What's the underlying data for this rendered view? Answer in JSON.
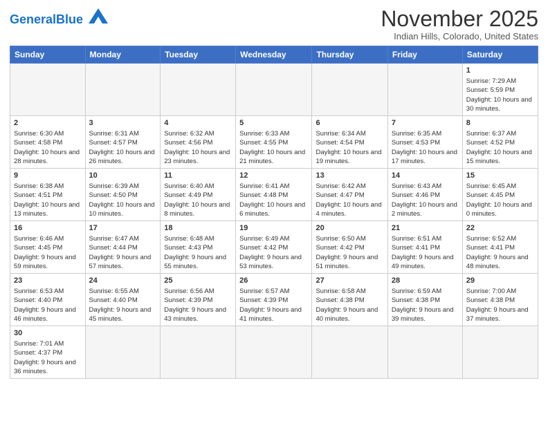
{
  "logo": {
    "text_general": "General",
    "text_blue": "Blue"
  },
  "title": "November 2025",
  "subtitle": "Indian Hills, Colorado, United States",
  "headers": [
    "Sunday",
    "Monday",
    "Tuesday",
    "Wednesday",
    "Thursday",
    "Friday",
    "Saturday"
  ],
  "weeks": [
    [
      {
        "num": "",
        "info": "",
        "empty": true
      },
      {
        "num": "",
        "info": "",
        "empty": true
      },
      {
        "num": "",
        "info": "",
        "empty": true
      },
      {
        "num": "",
        "info": "",
        "empty": true
      },
      {
        "num": "",
        "info": "",
        "empty": true
      },
      {
        "num": "",
        "info": "",
        "empty": true
      },
      {
        "num": "1",
        "info": "Sunrise: 7:29 AM\nSunset: 5:59 PM\nDaylight: 10 hours\nand 30 minutes.",
        "empty": false
      }
    ],
    [
      {
        "num": "2",
        "info": "Sunrise: 6:30 AM\nSunset: 4:58 PM\nDaylight: 10 hours\nand 28 minutes.",
        "empty": false
      },
      {
        "num": "3",
        "info": "Sunrise: 6:31 AM\nSunset: 4:57 PM\nDaylight: 10 hours\nand 26 minutes.",
        "empty": false
      },
      {
        "num": "4",
        "info": "Sunrise: 6:32 AM\nSunset: 4:56 PM\nDaylight: 10 hours\nand 23 minutes.",
        "empty": false
      },
      {
        "num": "5",
        "info": "Sunrise: 6:33 AM\nSunset: 4:55 PM\nDaylight: 10 hours\nand 21 minutes.",
        "empty": false
      },
      {
        "num": "6",
        "info": "Sunrise: 6:34 AM\nSunset: 4:54 PM\nDaylight: 10 hours\nand 19 minutes.",
        "empty": false
      },
      {
        "num": "7",
        "info": "Sunrise: 6:35 AM\nSunset: 4:53 PM\nDaylight: 10 hours\nand 17 minutes.",
        "empty": false
      },
      {
        "num": "8",
        "info": "Sunrise: 6:37 AM\nSunset: 4:52 PM\nDaylight: 10 hours\nand 15 minutes.",
        "empty": false
      }
    ],
    [
      {
        "num": "9",
        "info": "Sunrise: 6:38 AM\nSunset: 4:51 PM\nDaylight: 10 hours\nand 13 minutes.",
        "empty": false
      },
      {
        "num": "10",
        "info": "Sunrise: 6:39 AM\nSunset: 4:50 PM\nDaylight: 10 hours\nand 10 minutes.",
        "empty": false
      },
      {
        "num": "11",
        "info": "Sunrise: 6:40 AM\nSunset: 4:49 PM\nDaylight: 10 hours\nand 8 minutes.",
        "empty": false
      },
      {
        "num": "12",
        "info": "Sunrise: 6:41 AM\nSunset: 4:48 PM\nDaylight: 10 hours\nand 6 minutes.",
        "empty": false
      },
      {
        "num": "13",
        "info": "Sunrise: 6:42 AM\nSunset: 4:47 PM\nDaylight: 10 hours\nand 4 minutes.",
        "empty": false
      },
      {
        "num": "14",
        "info": "Sunrise: 6:43 AM\nSunset: 4:46 PM\nDaylight: 10 hours\nand 2 minutes.",
        "empty": false
      },
      {
        "num": "15",
        "info": "Sunrise: 6:45 AM\nSunset: 4:45 PM\nDaylight: 10 hours\nand 0 minutes.",
        "empty": false
      }
    ],
    [
      {
        "num": "16",
        "info": "Sunrise: 6:46 AM\nSunset: 4:45 PM\nDaylight: 9 hours\nand 59 minutes.",
        "empty": false
      },
      {
        "num": "17",
        "info": "Sunrise: 6:47 AM\nSunset: 4:44 PM\nDaylight: 9 hours\nand 57 minutes.",
        "empty": false
      },
      {
        "num": "18",
        "info": "Sunrise: 6:48 AM\nSunset: 4:43 PM\nDaylight: 9 hours\nand 55 minutes.",
        "empty": false
      },
      {
        "num": "19",
        "info": "Sunrise: 6:49 AM\nSunset: 4:42 PM\nDaylight: 9 hours\nand 53 minutes.",
        "empty": false
      },
      {
        "num": "20",
        "info": "Sunrise: 6:50 AM\nSunset: 4:42 PM\nDaylight: 9 hours\nand 51 minutes.",
        "empty": false
      },
      {
        "num": "21",
        "info": "Sunrise: 6:51 AM\nSunset: 4:41 PM\nDaylight: 9 hours\nand 49 minutes.",
        "empty": false
      },
      {
        "num": "22",
        "info": "Sunrise: 6:52 AM\nSunset: 4:41 PM\nDaylight: 9 hours\nand 48 minutes.",
        "empty": false
      }
    ],
    [
      {
        "num": "23",
        "info": "Sunrise: 6:53 AM\nSunset: 4:40 PM\nDaylight: 9 hours\nand 46 minutes.",
        "empty": false
      },
      {
        "num": "24",
        "info": "Sunrise: 6:55 AM\nSunset: 4:40 PM\nDaylight: 9 hours\nand 45 minutes.",
        "empty": false
      },
      {
        "num": "25",
        "info": "Sunrise: 6:56 AM\nSunset: 4:39 PM\nDaylight: 9 hours\nand 43 minutes.",
        "empty": false
      },
      {
        "num": "26",
        "info": "Sunrise: 6:57 AM\nSunset: 4:39 PM\nDaylight: 9 hours\nand 41 minutes.",
        "empty": false
      },
      {
        "num": "27",
        "info": "Sunrise: 6:58 AM\nSunset: 4:38 PM\nDaylight: 9 hours\nand 40 minutes.",
        "empty": false
      },
      {
        "num": "28",
        "info": "Sunrise: 6:59 AM\nSunset: 4:38 PM\nDaylight: 9 hours\nand 39 minutes.",
        "empty": false
      },
      {
        "num": "29",
        "info": "Sunrise: 7:00 AM\nSunset: 4:38 PM\nDaylight: 9 hours\nand 37 minutes.",
        "empty": false
      }
    ],
    [
      {
        "num": "30",
        "info": "Sunrise: 7:01 AM\nSunset: 4:37 PM\nDaylight: 9 hours\nand 36 minutes.",
        "empty": false
      },
      {
        "num": "",
        "info": "",
        "empty": true
      },
      {
        "num": "",
        "info": "",
        "empty": true
      },
      {
        "num": "",
        "info": "",
        "empty": true
      },
      {
        "num": "",
        "info": "",
        "empty": true
      },
      {
        "num": "",
        "info": "",
        "empty": true
      },
      {
        "num": "",
        "info": "",
        "empty": true
      }
    ]
  ]
}
